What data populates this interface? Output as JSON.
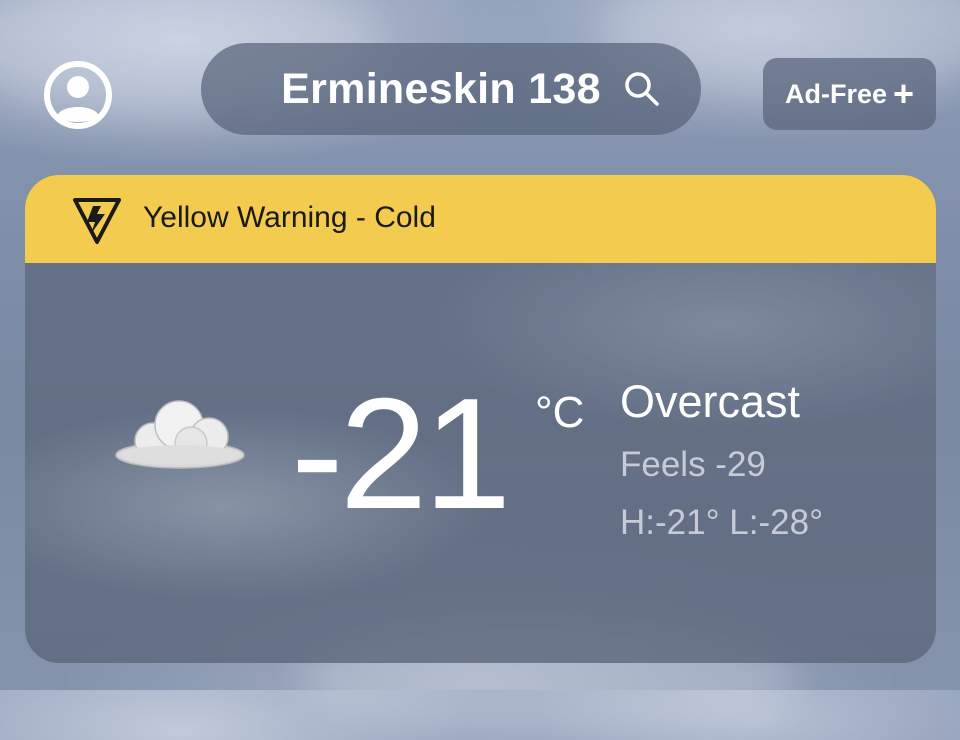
{
  "header": {
    "location": "Ermineskin 138",
    "ad_free_label": "Ad-Free",
    "ad_free_icon": "+",
    "icons": {
      "profile": "user-circle-icon",
      "search": "search-icon"
    }
  },
  "alert": {
    "text": "Yellow Warning - Cold",
    "icon": "warning-bolt-icon",
    "color": "#f3cc4f"
  },
  "current": {
    "temperature": "-21",
    "unit": "°C",
    "condition": "Overcast",
    "feels_like": "Feels -29",
    "high_low": "H:-21° L:-28°",
    "icon": "cloud-icon"
  }
}
